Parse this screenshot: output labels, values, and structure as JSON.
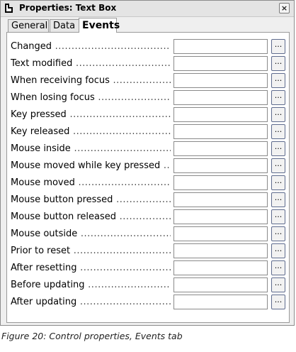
{
  "window": {
    "title": "Properties: Text Box",
    "close_glyph": "×"
  },
  "tabs": [
    {
      "label": "General",
      "active": false
    },
    {
      "label": "Data",
      "active": false
    },
    {
      "label": "Events",
      "active": true
    }
  ],
  "events": [
    {
      "label": "Changed",
      "value": "",
      "button_label": "..."
    },
    {
      "label": "Text modified",
      "value": "",
      "button_label": "..."
    },
    {
      "label": "When receiving focus",
      "value": "",
      "button_label": "..."
    },
    {
      "label": "When losing focus",
      "value": "",
      "button_label": "..."
    },
    {
      "label": "Key pressed",
      "value": "",
      "button_label": "..."
    },
    {
      "label": "Key released",
      "value": "",
      "button_label": "..."
    },
    {
      "label": "Mouse inside",
      "value": "",
      "button_label": "..."
    },
    {
      "label": "Mouse moved while key pressed",
      "value": "",
      "button_label": "..."
    },
    {
      "label": "Mouse moved",
      "value": "",
      "button_label": "..."
    },
    {
      "label": "Mouse button pressed",
      "value": "",
      "button_label": "..."
    },
    {
      "label": "Mouse button released",
      "value": "",
      "button_label": "..."
    },
    {
      "label": "Mouse outside",
      "value": "",
      "button_label": "..."
    },
    {
      "label": "Prior to reset",
      "value": "",
      "button_label": "..."
    },
    {
      "label": "After resetting",
      "value": "",
      "button_label": "..."
    },
    {
      "label": "Before updating",
      "value": "",
      "button_label": "..."
    },
    {
      "label": "After updating",
      "value": "",
      "button_label": "..."
    }
  ],
  "caption": "Figure 20: Control properties, Events tab"
}
